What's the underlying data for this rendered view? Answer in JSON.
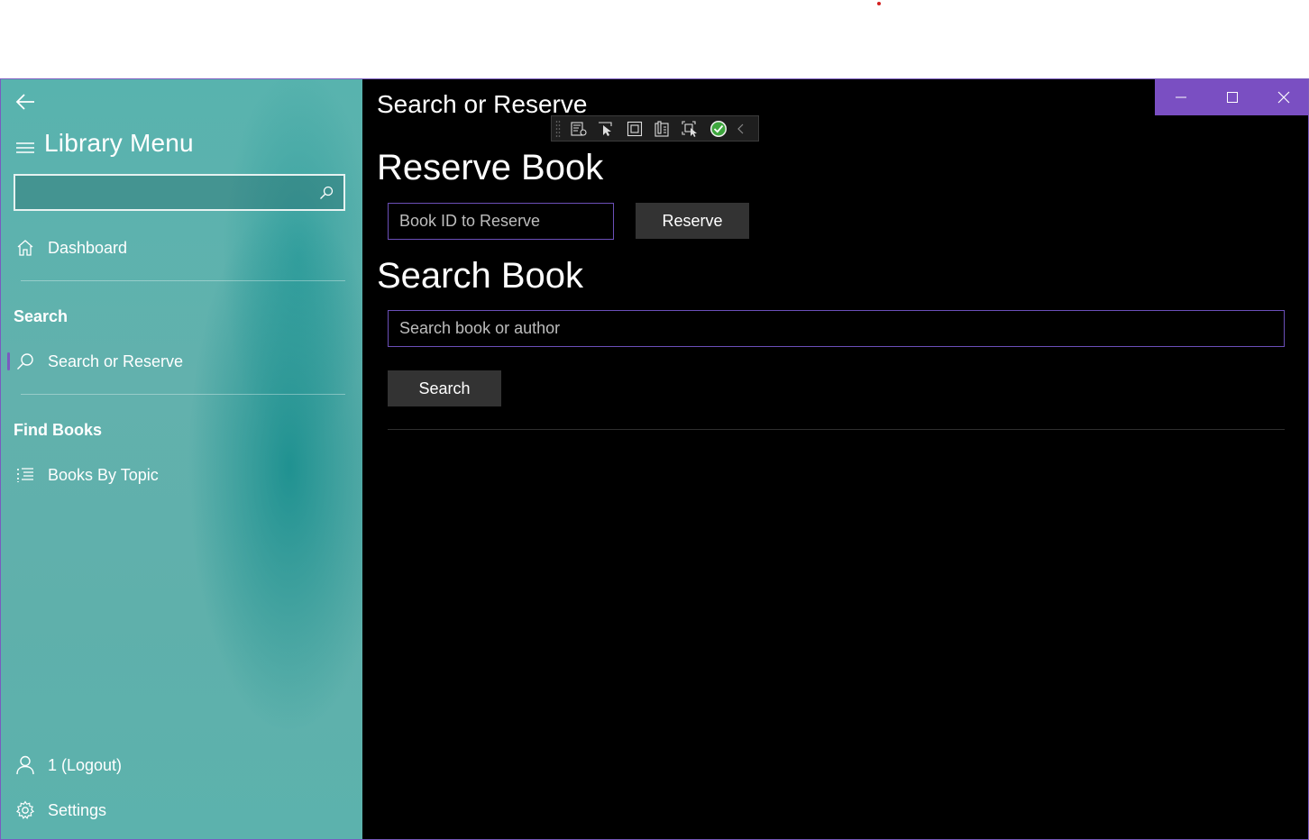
{
  "nav": {
    "title": "Library Menu",
    "search_placeholder": "",
    "items": [
      {
        "label": "Dashboard",
        "icon": "home-icon"
      },
      {
        "label": "Search or Reserve",
        "icon": "search-icon",
        "selected": true
      },
      {
        "label": "Books By Topic",
        "icon": "list-icon"
      }
    ],
    "headers": {
      "search": "Search",
      "find_books": "Find Books"
    },
    "footer": {
      "account": "1 (Logout)",
      "settings": "Settings"
    }
  },
  "page": {
    "title": "Search or Reserve",
    "reserve": {
      "heading": "Reserve Book",
      "input_placeholder": "Book ID to Reserve",
      "button_label": "Reserve"
    },
    "search": {
      "heading": "Search Book",
      "input_placeholder": "Search book or author",
      "button_label": "Search"
    }
  },
  "colors": {
    "accent": "#7a4fc2",
    "nav_background": "#5fb0ab",
    "content_background": "#000000",
    "button_background": "#333333"
  }
}
